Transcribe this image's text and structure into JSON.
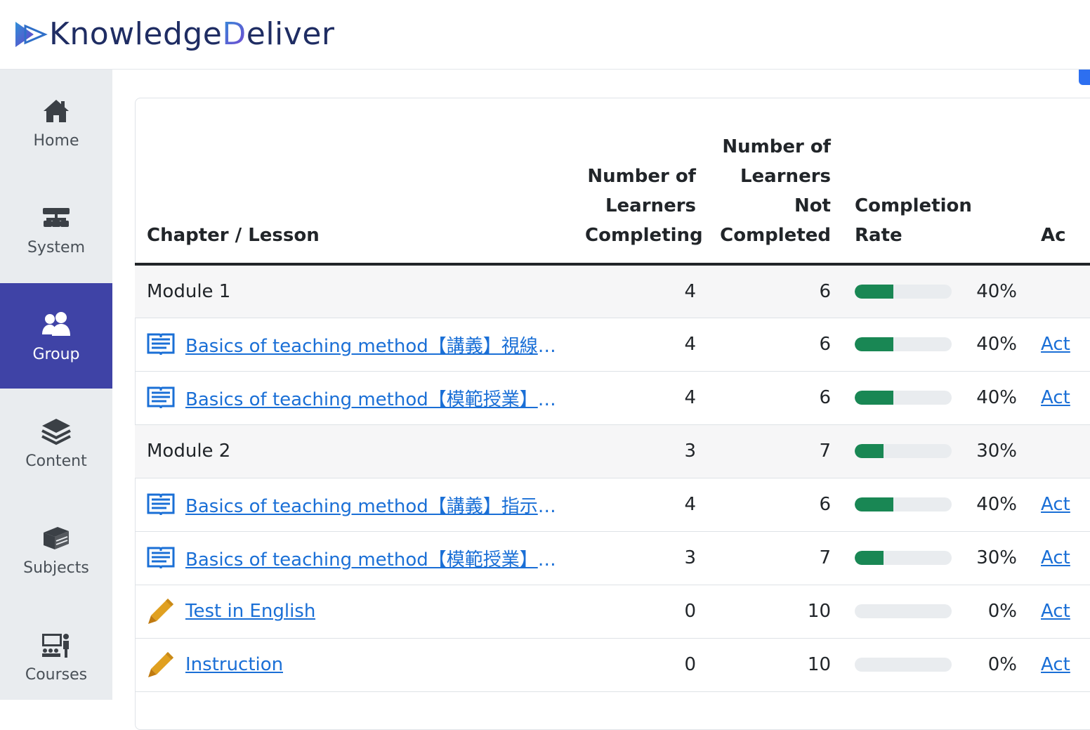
{
  "app": {
    "brand_part1": "Knowledge",
    "brand_accent": "D",
    "brand_part2": "eliver"
  },
  "sidebar": {
    "items": [
      {
        "label": "Home",
        "icon": "home-icon"
      },
      {
        "label": "System",
        "icon": "system-icon"
      },
      {
        "label": "Group",
        "icon": "group-icon",
        "active": true
      },
      {
        "label": "Content",
        "icon": "layers-icon"
      },
      {
        "label": "Subjects",
        "icon": "book-stack-icon"
      },
      {
        "label": "Courses",
        "icon": "teacher-icon"
      }
    ]
  },
  "table": {
    "headers": {
      "lesson": "Chapter / Lesson",
      "completing": "Number of Learners Completing",
      "not_completed": "Number of Learners Not Completed",
      "rate": "Completion Rate",
      "actions": "Ac"
    },
    "rows": [
      {
        "type": "module",
        "title": "Module 1",
        "completing": "4",
        "not_completed": "6",
        "rate": 0.4,
        "rate_text": "40%",
        "action": ""
      },
      {
        "type": "lesson",
        "icon": "book-open-icon",
        "title": "Basics of teaching method【講義】視線（集…",
        "completing": "4",
        "not_completed": "6",
        "rate": 0.4,
        "rate_text": "40%",
        "action": "Act"
      },
      {
        "type": "lesson",
        "icon": "book-open-icon",
        "title": "Basics of teaching method【模範授業】視線…",
        "completing": "4",
        "not_completed": "6",
        "rate": 0.4,
        "rate_text": "40%",
        "action": "Act"
      },
      {
        "type": "module",
        "title": "Module 2",
        "completing": "3",
        "not_completed": "7",
        "rate": 0.3,
        "rate_text": "30%",
        "action": ""
      },
      {
        "type": "lesson",
        "icon": "book-open-icon",
        "title": "Basics of teaching method【講義】指示（集…",
        "completing": "4",
        "not_completed": "6",
        "rate": 0.4,
        "rate_text": "40%",
        "action": "Act"
      },
      {
        "type": "lesson",
        "icon": "book-open-icon",
        "title": "Basics of teaching method【模範授業】指示…",
        "completing": "3",
        "not_completed": "7",
        "rate": 0.3,
        "rate_text": "30%",
        "action": "Act"
      },
      {
        "type": "lesson",
        "icon": "pencil-icon",
        "title": "Test in English",
        "completing": "0",
        "not_completed": "10",
        "rate": 0,
        "rate_text": "0%",
        "action": "Act"
      },
      {
        "type": "lesson",
        "icon": "pencil-icon",
        "title": "Instruction",
        "completing": "0",
        "not_completed": "10",
        "rate": 0,
        "rate_text": "0%",
        "action": "Act"
      }
    ]
  },
  "colors": {
    "sidebar_active": "#3f43a6",
    "progress_fill": "#198754",
    "link": "#1a6fd6"
  }
}
